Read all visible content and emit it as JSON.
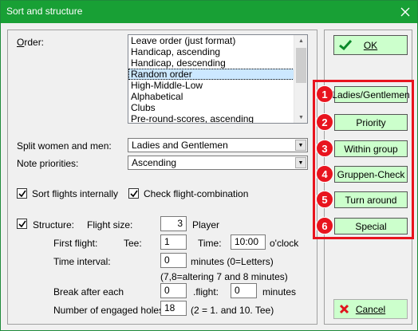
{
  "window": {
    "title": "Sort and structure"
  },
  "order": {
    "label": "Order:",
    "items": [
      "Leave order (just format)",
      "Handicap, ascending",
      "Handicap, descending",
      "Random order",
      "High-Middle-Low",
      "Alphabetical",
      "Clubs",
      "Pre-round-scores, ascending"
    ],
    "selected": "Random order"
  },
  "split": {
    "label": "Split women and men:",
    "value": "Ladies and Gentlemen"
  },
  "priorities": {
    "label": "Note priorities:",
    "value": "Ascending"
  },
  "options": {
    "sort_flights_label": "Sort flights internally",
    "sort_flights_checked": true,
    "check_flight_label": "Check flight-combination",
    "check_flight_checked": true
  },
  "structure": {
    "label": "Structure:",
    "checked": true,
    "flight_size_label": "Flight size:",
    "flight_size": "3",
    "player_label": "Player",
    "first_flight_label": "First flight:",
    "tee_label": "Tee:",
    "tee": "1",
    "time_label": "Time:",
    "time": "10:00",
    "oclock_label": "o'clock",
    "interval_label": "Time interval:",
    "interval": "0",
    "interval_unit": "minutes (0=Letters)",
    "interval_note": "(7,8=altering 7 and 8 minutes)",
    "break_label": "Break after each",
    "break_after": "0",
    "flight_label": ".flight:",
    "break_minutes": "0",
    "minutes_label": "minutes",
    "holes_label": "Number of engaged holes",
    "holes": "18",
    "holes_note": "(2 = 1. and 10. Tee)"
  },
  "buttons": {
    "ok": "OK",
    "cancel": "Cancel",
    "side": [
      {
        "badge": "1",
        "label": "Ladies/Gentlemen"
      },
      {
        "badge": "2",
        "label": "Priority"
      },
      {
        "badge": "3",
        "label": "Within group"
      },
      {
        "badge": "4",
        "label": "Gruppen-Check"
      },
      {
        "badge": "5",
        "label": "Turn around"
      },
      {
        "badge": "6",
        "label": "Special"
      }
    ]
  },
  "colors": {
    "titlebar": "#18a035",
    "highlight": "#e8141e",
    "selection": "#cce8ff"
  },
  "icons": {
    "ok": "checkmark-icon",
    "cancel": "cross-icon",
    "close": "close-icon"
  }
}
